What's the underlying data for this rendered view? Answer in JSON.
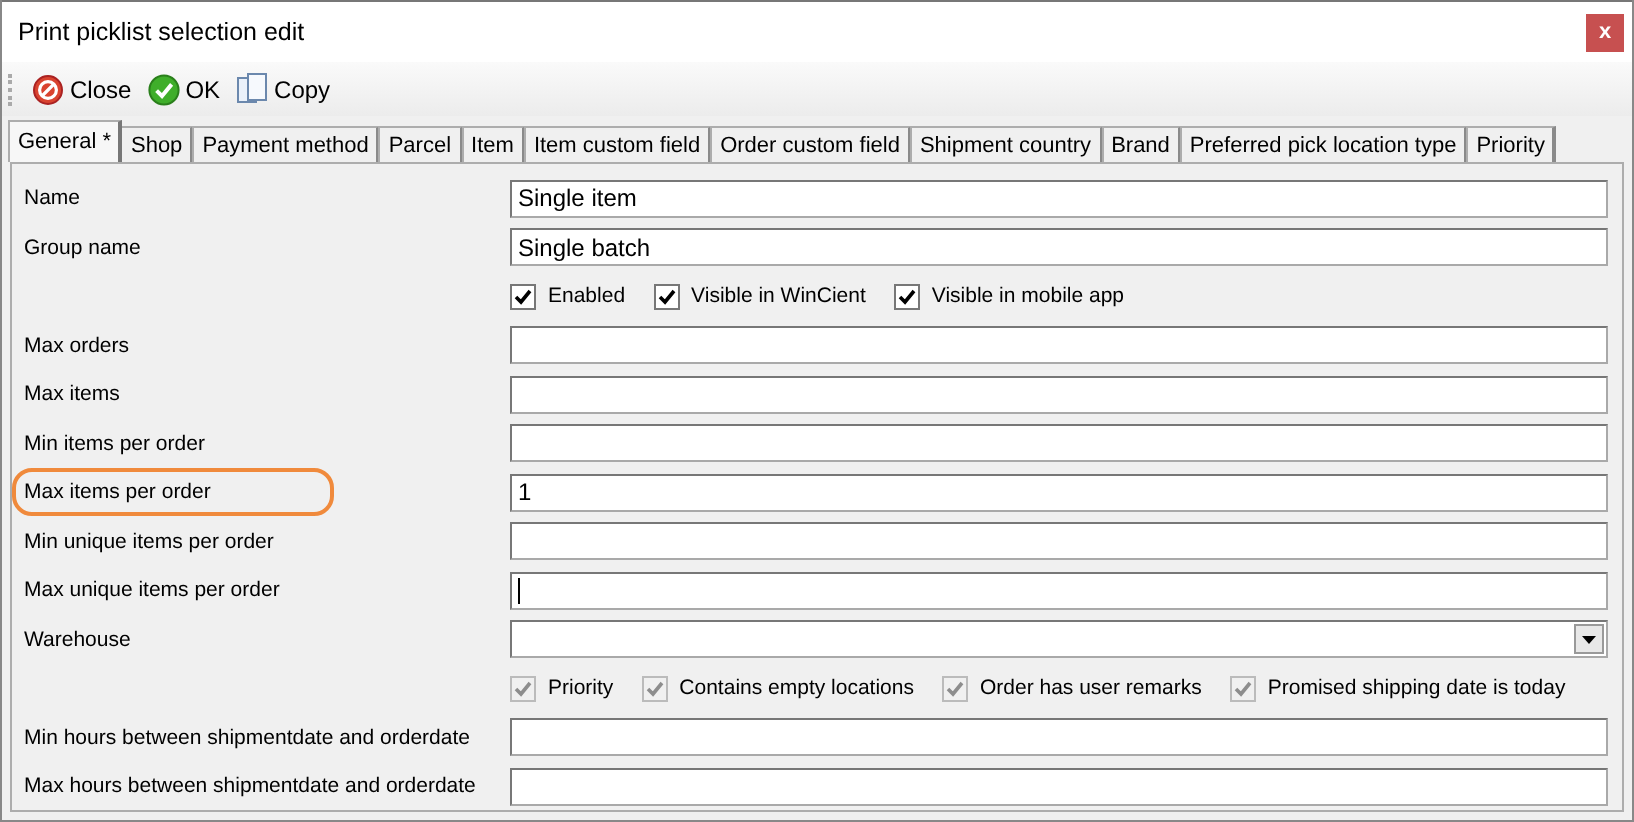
{
  "window": {
    "title": "Print picklist selection edit",
    "close": "x"
  },
  "toolbar": [
    {
      "kind": "close",
      "label": "Close"
    },
    {
      "kind": "ok",
      "label": "OK"
    },
    {
      "kind": "copy",
      "label": "Copy"
    }
  ],
  "tabs": [
    {
      "label": "General *",
      "selected": true
    },
    {
      "label": "Shop",
      "selected": false
    },
    {
      "label": "Payment method",
      "selected": false
    },
    {
      "label": "Parcel",
      "selected": false
    },
    {
      "label": "Item",
      "selected": false
    },
    {
      "label": "Item custom field",
      "selected": false
    },
    {
      "label": "Order custom field",
      "selected": false
    },
    {
      "label": "Shipment country",
      "selected": false
    },
    {
      "label": "Brand",
      "selected": false
    },
    {
      "label": "Preferred pick location type",
      "selected": false
    },
    {
      "label": "Priority",
      "selected": false
    }
  ],
  "rows": [
    {
      "kind": "text",
      "label": "Name",
      "value": "Single item",
      "highlighted": false
    },
    {
      "kind": "text",
      "label": "Group name",
      "value": "Single batch",
      "highlighted": false
    },
    {
      "kind": "checks",
      "checks": [
        {
          "label": "Enabled",
          "checked": true,
          "disabled": false
        },
        {
          "label": "Visible in WinCient",
          "checked": true,
          "disabled": false
        },
        {
          "label": "Visible in mobile app",
          "checked": true,
          "disabled": false
        }
      ]
    },
    {
      "kind": "text",
      "label": "Max orders",
      "highlighted": false
    },
    {
      "kind": "text",
      "label": "Max items",
      "highlighted": false
    },
    {
      "kind": "text",
      "label": "Min items per order",
      "highlighted": false
    },
    {
      "kind": "text",
      "label": "Max items per order",
      "value": "1",
      "highlighted": true
    },
    {
      "kind": "text",
      "label": "Min unique items per order",
      "highlighted": false
    },
    {
      "kind": "text",
      "label": "Max unique items per order",
      "highlighted": false,
      "focused": true
    },
    {
      "kind": "select",
      "label": "Warehouse",
      "highlighted": false
    },
    {
      "kind": "checks",
      "checks": [
        {
          "label": "Priority",
          "checked": true,
          "disabled": true
        },
        {
          "label": "Contains empty locations",
          "checked": true,
          "disabled": true
        },
        {
          "label": "Order has user remarks",
          "checked": true,
          "disabled": true
        },
        {
          "label": "Promised shipping date is today",
          "checked": true,
          "disabled": true
        }
      ]
    },
    {
      "kind": "text",
      "label": "Min hours between shipmentdate and orderdate",
      "highlighted": false
    },
    {
      "kind": "text",
      "label": "Max hours between shipmentdate and orderdate",
      "highlighted": false
    }
  ]
}
